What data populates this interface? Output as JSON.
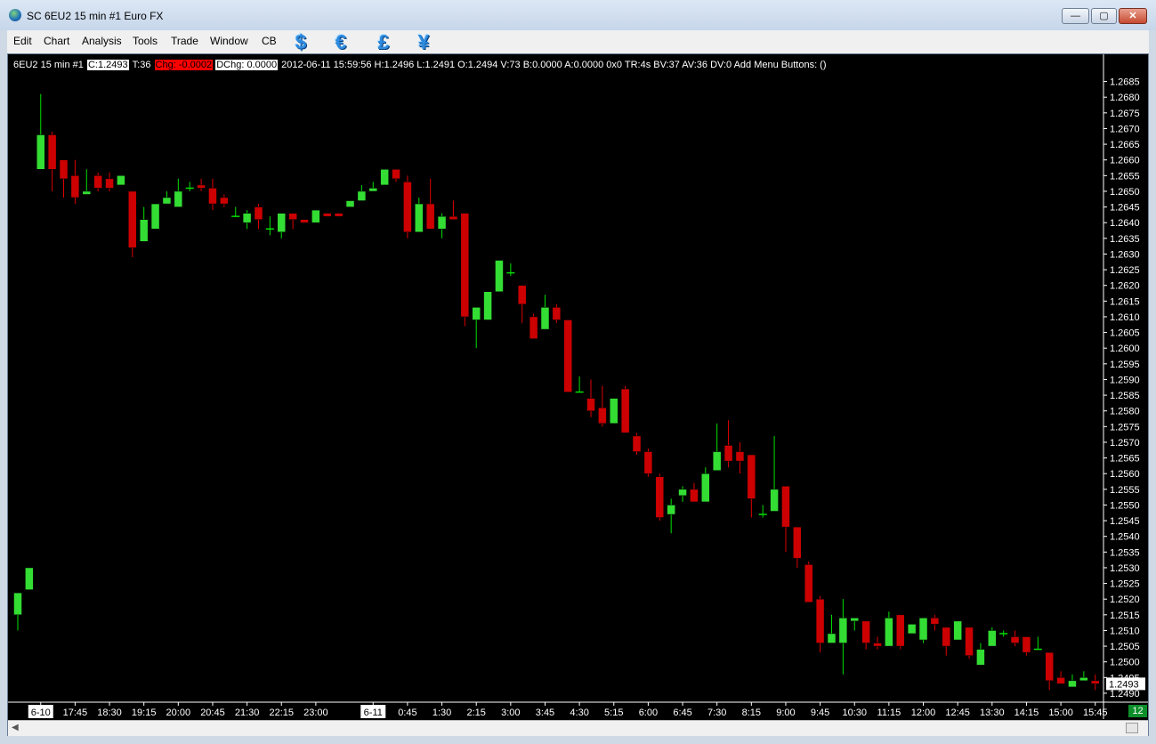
{
  "window": {
    "title": "SC 6EU2  15 min  #1  Euro FX",
    "minimize": "—",
    "maximize": "▢",
    "close": "✕"
  },
  "menu": {
    "items": [
      "Edit",
      "Chart",
      "Analysis",
      "Tools",
      "Trade",
      "Window",
      "CB"
    ],
    "currency_icons": [
      "$",
      "€",
      "£",
      "¥"
    ]
  },
  "infoline": {
    "symbol": "6EU2  15 min   #1",
    "close": "C:1.2493",
    "trades": "T:36",
    "chg": "Chg: -0.0002",
    "dchg": "DChg: 0.0000",
    "rest": "2012-06-11 15:59:56 H:1.2496 L:1.2491 O:1.2494 V:73 B:0.0000 A:0.0000 0x0 TR:4s BV:37 AV:36 DV:0  Add Menu Buttons:  ()"
  },
  "badge": "12",
  "colors": {
    "up": "#00e000",
    "down": "#e00000",
    "up_body": "#33dd33",
    "down_body": "#cc0000",
    "background": "#000000",
    "axis_text": "#ffffff"
  },
  "chart_data": {
    "type": "candlestick",
    "ylim": [
      1.2488,
      1.2688
    ],
    "y_ticks": [
      1.2685,
      1.268,
      1.2675,
      1.267,
      1.2665,
      1.266,
      1.2655,
      1.265,
      1.2645,
      1.264,
      1.2635,
      1.263,
      1.2625,
      1.262,
      1.2615,
      1.261,
      1.2605,
      1.26,
      1.2595,
      1.259,
      1.2585,
      1.258,
      1.2575,
      1.257,
      1.2565,
      1.256,
      1.2555,
      1.255,
      1.2545,
      1.254,
      1.2535,
      1.253,
      1.2525,
      1.252,
      1.2515,
      1.251,
      1.2505,
      1.25,
      1.2495,
      1.249
    ],
    "last_price": "1.2493",
    "x_labels": [
      {
        "label": "6-10",
        "bar": 2,
        "boxed": true
      },
      {
        "label": "17:45",
        "bar": 5
      },
      {
        "label": "18:30",
        "bar": 8
      },
      {
        "label": "19:15",
        "bar": 11
      },
      {
        "label": "20:00",
        "bar": 14
      },
      {
        "label": "20:45",
        "bar": 17
      },
      {
        "label": "21:30",
        "bar": 20
      },
      {
        "label": "22:15",
        "bar": 23
      },
      {
        "label": "23:00",
        "bar": 26
      },
      {
        "label": "6-11",
        "bar": 31,
        "boxed": true
      },
      {
        "label": "0:45",
        "bar": 34
      },
      {
        "label": "1:30",
        "bar": 37
      },
      {
        "label": "2:15",
        "bar": 40
      },
      {
        "label": "3:00",
        "bar": 43
      },
      {
        "label": "3:45",
        "bar": 46
      },
      {
        "label": "4:30",
        "bar": 49
      },
      {
        "label": "5:15",
        "bar": 52
      },
      {
        "label": "6:00",
        "bar": 55
      },
      {
        "label": "6:45",
        "bar": 58
      },
      {
        "label": "7:30",
        "bar": 61
      },
      {
        "label": "8:15",
        "bar": 64
      },
      {
        "label": "9:00",
        "bar": 67
      },
      {
        "label": "9:45",
        "bar": 70
      },
      {
        "label": "10:30",
        "bar": 73
      },
      {
        "label": "11:15",
        "bar": 76
      },
      {
        "label": "12:00",
        "bar": 79
      },
      {
        "label": "12:45",
        "bar": 82
      },
      {
        "label": "13:30",
        "bar": 85
      },
      {
        "label": "14:15",
        "bar": 88
      },
      {
        "label": "15:00",
        "bar": 91
      },
      {
        "label": "15:45",
        "bar": 94
      }
    ],
    "candles": [
      [
        1.2515,
        1.2522,
        1.251,
        1.2522
      ],
      [
        1.2523,
        1.253,
        1.2523,
        1.253
      ],
      [
        1.2657,
        1.2681,
        1.2657,
        1.2668
      ],
      [
        1.2668,
        1.2669,
        1.265,
        1.2657
      ],
      [
        1.266,
        1.266,
        1.2648,
        1.2654
      ],
      [
        1.2655,
        1.266,
        1.2646,
        1.2648
      ],
      [
        1.2649,
        1.2657,
        1.2649,
        1.265
      ],
      [
        1.2655,
        1.2656,
        1.265,
        1.2651
      ],
      [
        1.2654,
        1.2656,
        1.265,
        1.2651
      ],
      [
        1.2652,
        1.2655,
        1.2652,
        1.2655
      ],
      [
        1.265,
        1.265,
        1.2629,
        1.2632
      ],
      [
        1.2634,
        1.2645,
        1.2634,
        1.2641
      ],
      [
        1.2638,
        1.2646,
        1.2638,
        1.2646
      ],
      [
        1.2646,
        1.265,
        1.2646,
        1.2648
      ],
      [
        1.2645,
        1.2654,
        1.2645,
        1.265
      ],
      [
        1.2651,
        1.2653,
        1.265,
        1.2651
      ],
      [
        1.2652,
        1.2654,
        1.265,
        1.2651
      ],
      [
        1.2651,
        1.2654,
        1.2644,
        1.2646
      ],
      [
        1.2648,
        1.2649,
        1.2645,
        1.2646
      ],
      [
        1.2642,
        1.2645,
        1.2642,
        1.2642
      ],
      [
        1.264,
        1.2644,
        1.2638,
        1.2643
      ],
      [
        1.2645,
        1.2646,
        1.2638,
        1.2641
      ],
      [
        1.2638,
        1.2642,
        1.2636,
        1.2638
      ],
      [
        1.2637,
        1.2643,
        1.2635,
        1.2643
      ],
      [
        1.2643,
        1.2643,
        1.2638,
        1.2641
      ],
      [
        1.2641,
        1.2641,
        1.264,
        1.264
      ],
      [
        1.264,
        1.2644,
        1.264,
        1.2644
      ],
      [
        1.2643,
        1.2643,
        1.2642,
        1.2642
      ],
      [
        1.2643,
        1.2643,
        1.2642,
        1.2642
      ],
      [
        1.2645,
        1.2647,
        1.2645,
        1.2647
      ],
      [
        1.2647,
        1.2652,
        1.2647,
        1.265
      ],
      [
        1.265,
        1.2653,
        1.265,
        1.2651
      ],
      [
        1.2652,
        1.2657,
        1.2652,
        1.2657
      ],
      [
        1.2657,
        1.2657,
        1.2653,
        1.2654
      ],
      [
        1.2653,
        1.2655,
        1.2635,
        1.2637
      ],
      [
        1.2637,
        1.2648,
        1.2637,
        1.2646
      ],
      [
        1.2646,
        1.2654,
        1.2638,
        1.2638
      ],
      [
        1.2638,
        1.2643,
        1.2635,
        1.2642
      ],
      [
        1.2642,
        1.2647,
        1.2641,
        1.2641
      ],
      [
        1.2643,
        1.2643,
        1.2607,
        1.261
      ],
      [
        1.2609,
        1.2613,
        1.26,
        1.2613
      ],
      [
        1.2609,
        1.2618,
        1.2609,
        1.2618
      ],
      [
        1.2618,
        1.2628,
        1.2618,
        1.2628
      ],
      [
        1.2624,
        1.2627,
        1.2623,
        1.2624
      ],
      [
        1.262,
        1.262,
        1.2608,
        1.2614
      ],
      [
        1.261,
        1.2611,
        1.2603,
        1.2603
      ],
      [
        1.2606,
        1.2617,
        1.2606,
        1.2613
      ],
      [
        1.2613,
        1.2614,
        1.2608,
        1.2609
      ],
      [
        1.2609,
        1.2609,
        1.2586,
        1.2586
      ],
      [
        1.2586,
        1.2591,
        1.2586,
        1.2586
      ],
      [
        1.2584,
        1.259,
        1.2578,
        1.258
      ],
      [
        1.2581,
        1.2588,
        1.2575,
        1.2576
      ],
      [
        1.2576,
        1.2584,
        1.2576,
        1.2584
      ],
      [
        1.2587,
        1.2588,
        1.2573,
        1.2573
      ],
      [
        1.2572,
        1.2573,
        1.2566,
        1.2567
      ],
      [
        1.2567,
        1.2568,
        1.2559,
        1.256
      ],
      [
        1.2559,
        1.256,
        1.2545,
        1.2546
      ],
      [
        1.2547,
        1.2552,
        1.2541,
        1.255
      ],
      [
        1.2553,
        1.2556,
        1.2551,
        1.2555
      ],
      [
        1.2555,
        1.2557,
        1.2551,
        1.2551
      ],
      [
        1.2551,
        1.2562,
        1.2551,
        1.256
      ],
      [
        1.2561,
        1.2576,
        1.2561,
        1.2567
      ],
      [
        1.2569,
        1.2577,
        1.2562,
        1.2564
      ],
      [
        1.2567,
        1.257,
        1.256,
        1.2564
      ],
      [
        1.2566,
        1.2566,
        1.2546,
        1.2552
      ],
      [
        1.2547,
        1.255,
        1.2546,
        1.2547
      ],
      [
        1.2548,
        1.2572,
        1.2548,
        1.2555
      ],
      [
        1.2556,
        1.2556,
        1.2535,
        1.2543
      ],
      [
        1.2543,
        1.2543,
        1.253,
        1.2533
      ],
      [
        1.2531,
        1.2532,
        1.2519,
        1.2519
      ],
      [
        1.252,
        1.2521,
        1.2503,
        1.2506
      ],
      [
        1.2506,
        1.2515,
        1.2506,
        1.2509
      ],
      [
        1.2506,
        1.252,
        1.2496,
        1.2514
      ],
      [
        1.2513,
        1.2514,
        1.251,
        1.2514
      ],
      [
        1.2513,
        1.2513,
        1.2504,
        1.2506
      ],
      [
        1.2506,
        1.2508,
        1.2504,
        1.2505
      ],
      [
        1.2505,
        1.2516,
        1.2505,
        1.2514
      ],
      [
        1.2515,
        1.2515,
        1.2504,
        1.2505
      ],
      [
        1.2509,
        1.2512,
        1.2509,
        1.2512
      ],
      [
        1.2507,
        1.2514,
        1.2506,
        1.2514
      ],
      [
        1.2514,
        1.2515,
        1.251,
        1.2512
      ],
      [
        1.2511,
        1.2511,
        1.2502,
        1.2505
      ],
      [
        1.2507,
        1.2513,
        1.2507,
        1.2513
      ],
      [
        1.2511,
        1.2511,
        1.2501,
        1.2502
      ],
      [
        1.2499,
        1.2506,
        1.2499,
        1.2504
      ],
      [
        1.2505,
        1.2511,
        1.2505,
        1.251
      ],
      [
        1.2509,
        1.251,
        1.2508,
        1.2509
      ],
      [
        1.2508,
        1.251,
        1.2505,
        1.2506
      ],
      [
        1.2508,
        1.2508,
        1.2502,
        1.2503
      ],
      [
        1.2504,
        1.2508,
        1.2504,
        1.2504
      ],
      [
        1.2503,
        1.2503,
        1.2491,
        1.2494
      ],
      [
        1.2495,
        1.2497,
        1.2493,
        1.2493
      ],
      [
        1.2492,
        1.2496,
        1.2492,
        1.2494
      ],
      [
        1.2494,
        1.2497,
        1.2494,
        1.2495
      ],
      [
        1.2494,
        1.2496,
        1.2491,
        1.2493
      ]
    ]
  }
}
